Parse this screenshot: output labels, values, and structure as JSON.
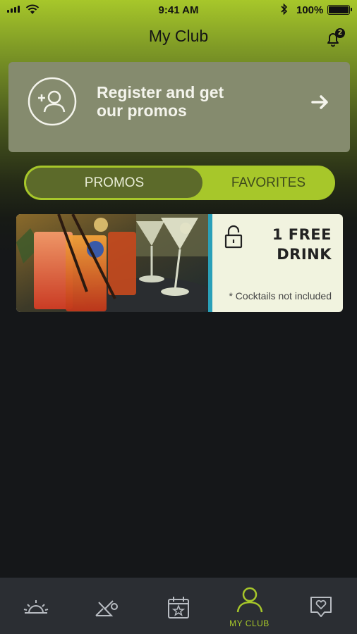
{
  "status_bar": {
    "time": "9:41 AM",
    "battery_percent": "100%",
    "icons": [
      "signal-icon",
      "wifi-icon",
      "bluetooth-icon",
      "battery-icon"
    ]
  },
  "header": {
    "title": "My Club",
    "notification_count": "2",
    "icon": "bell-icon"
  },
  "register_card": {
    "line1": "Register and get",
    "line2": "our promos",
    "icons": [
      "add-user-icon",
      "arrow-right-icon"
    ]
  },
  "tabs": {
    "items": [
      {
        "label": "PROMOS",
        "active": true
      },
      {
        "label": "FAVORITES",
        "active": false
      }
    ]
  },
  "promo": {
    "offer_line1": "1 FREE",
    "offer_line2": "DRINK",
    "note": "* Cocktails not included",
    "icons": [
      "unlock-icon"
    ]
  },
  "tab_bar": {
    "items": [
      {
        "icon": "sunrise-icon",
        "label": ""
      },
      {
        "icon": "wellness-icon",
        "label": ""
      },
      {
        "icon": "calendar-star-icon",
        "label": ""
      },
      {
        "icon": "user-icon",
        "label": "MY CLUB",
        "active": true
      },
      {
        "icon": "heart-chat-icon",
        "label": ""
      }
    ]
  },
  "colors": {
    "accent": "#a7c72a",
    "card": "#858b6e",
    "background": "#151719",
    "tabbar": "#2b2e33"
  }
}
